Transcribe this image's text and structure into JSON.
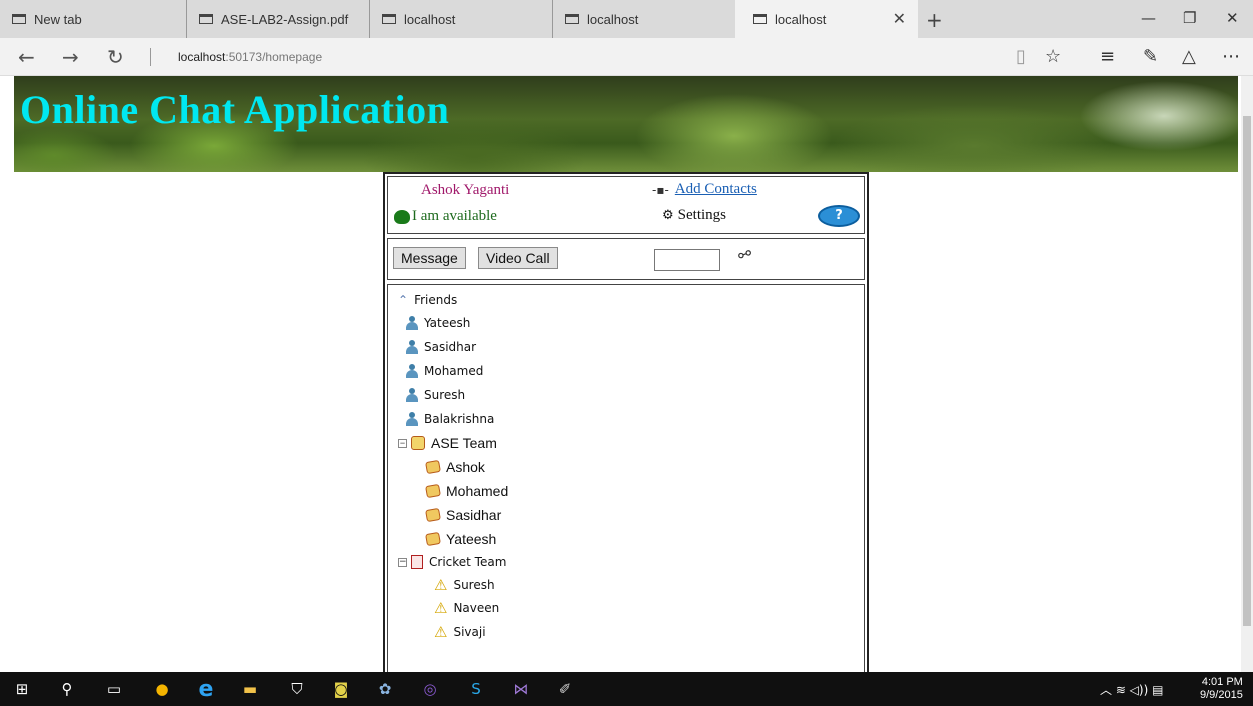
{
  "browser": {
    "tabs": [
      {
        "label": "New tab"
      },
      {
        "label": "ASE-LAB2-Assign.pdf"
      },
      {
        "label": "localhost"
      },
      {
        "label": "localhost"
      },
      {
        "label": "localhost",
        "active": true
      }
    ],
    "url_host": "localhost",
    "url_rest": ":50173/homepage"
  },
  "page": {
    "banner_title": "Online Chat Application",
    "user": {
      "name": "Ashok Yaganti",
      "status": "I am available"
    },
    "links": {
      "add_contacts": "Add Contacts",
      "settings": "Settings"
    },
    "toolbar": {
      "message_label": "Message",
      "videocall_label": "Video Call"
    },
    "tree": {
      "friends_label": "Friends",
      "friends": [
        "Yateesh",
        "Sasidhar",
        "Mohamed",
        "Suresh",
        "Balakrishna"
      ],
      "groups": [
        {
          "name": "ASE Team",
          "members": [
            "Ashok",
            "Mohamed",
            "Sasidhar",
            "Yateesh"
          ]
        },
        {
          "name": "Cricket Team",
          "members": [
            "Suresh",
            "Naveen",
            "Sivaji"
          ]
        }
      ]
    }
  },
  "taskbar": {
    "time": "4:01 PM",
    "date": "9/9/2015"
  },
  "colors": {
    "banner_title": "#00e8f0",
    "username": "#a0186a",
    "status": "#1d6a1d",
    "link": "#1a5fb4"
  }
}
